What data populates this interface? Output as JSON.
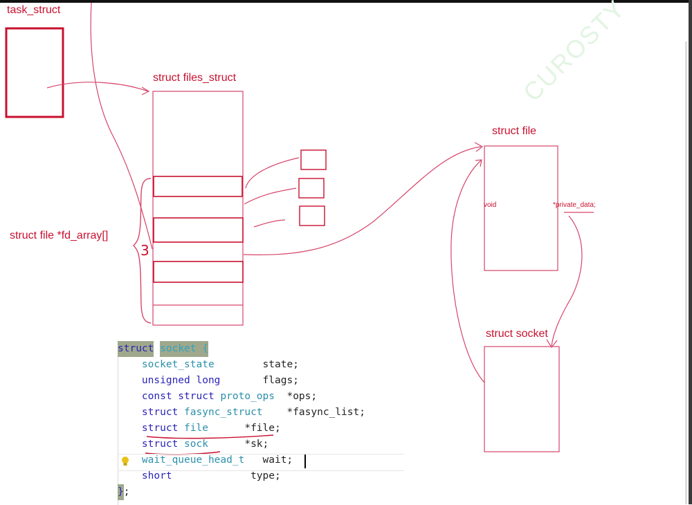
{
  "labels": {
    "task_struct": "task_struct",
    "files_struct": "struct files_struct",
    "fd_array": "struct file *fd_array[]",
    "struct_file": "struct file",
    "void": "void",
    "private_data": "*private_data;",
    "struct_socket": "struct socket",
    "annotation_3": "3"
  },
  "watermark": "CUROSTY",
  "code": {
    "lines": [
      {
        "tokens": [
          {
            "t": "struct",
            "c": "hl-struct"
          },
          {
            "t": " ",
            "c": "tx"
          },
          {
            "t": "socket {",
            "c": "hl-name"
          }
        ]
      },
      {
        "tokens": [
          {
            "t": "    ",
            "c": "tx"
          },
          {
            "t": "socket_state",
            "c": "ty"
          },
          {
            "t": "        state;",
            "c": "tx"
          }
        ]
      },
      {
        "tokens": [
          {
            "t": "    ",
            "c": "tx"
          },
          {
            "t": "unsigned long",
            "c": "kw"
          },
          {
            "t": "       flags;",
            "c": "tx"
          }
        ]
      },
      {
        "tokens": [
          {
            "t": "    ",
            "c": "tx"
          },
          {
            "t": "const struct",
            "c": "kw"
          },
          {
            "t": " ",
            "c": "tx"
          },
          {
            "t": "proto_ops",
            "c": "ty"
          },
          {
            "t": "  *ops;",
            "c": "tx"
          }
        ]
      },
      {
        "tokens": [
          {
            "t": "    ",
            "c": "tx"
          },
          {
            "t": "struct",
            "c": "kw"
          },
          {
            "t": " ",
            "c": "tx"
          },
          {
            "t": "fasync_struct",
            "c": "ty"
          },
          {
            "t": "    *fasync_list;",
            "c": "tx"
          }
        ]
      },
      {
        "tokens": [
          {
            "t": "    ",
            "c": "tx"
          },
          {
            "t": "struct",
            "c": "kw"
          },
          {
            "t": " ",
            "c": "tx"
          },
          {
            "t": "file",
            "c": "ty"
          },
          {
            "t": "      *file;",
            "c": "tx"
          }
        ]
      },
      {
        "tokens": [
          {
            "t": "    ",
            "c": "tx"
          },
          {
            "t": "struct",
            "c": "kw"
          },
          {
            "t": " ",
            "c": "tx"
          },
          {
            "t": "sock",
            "c": "ty"
          },
          {
            "t": "      *sk;",
            "c": "tx"
          }
        ]
      },
      {
        "tokens": [
          {
            "t": "    ",
            "c": "tx"
          },
          {
            "t": "wait_queue_head_t",
            "c": "ty"
          },
          {
            "t": "   wait;",
            "c": "tx"
          }
        ]
      },
      {
        "tokens": [
          {
            "t": "    ",
            "c": "tx"
          },
          {
            "t": "short",
            "c": "kw"
          },
          {
            "t": "             type;",
            "c": "tx"
          }
        ]
      },
      {
        "tokens": [
          {
            "t": "}",
            "c": "hl-struct"
          },
          {
            "t": ";",
            "c": "tx"
          }
        ]
      }
    ]
  },
  "colors": {
    "ink": "#c8102e",
    "pen": "#d6446a"
  }
}
